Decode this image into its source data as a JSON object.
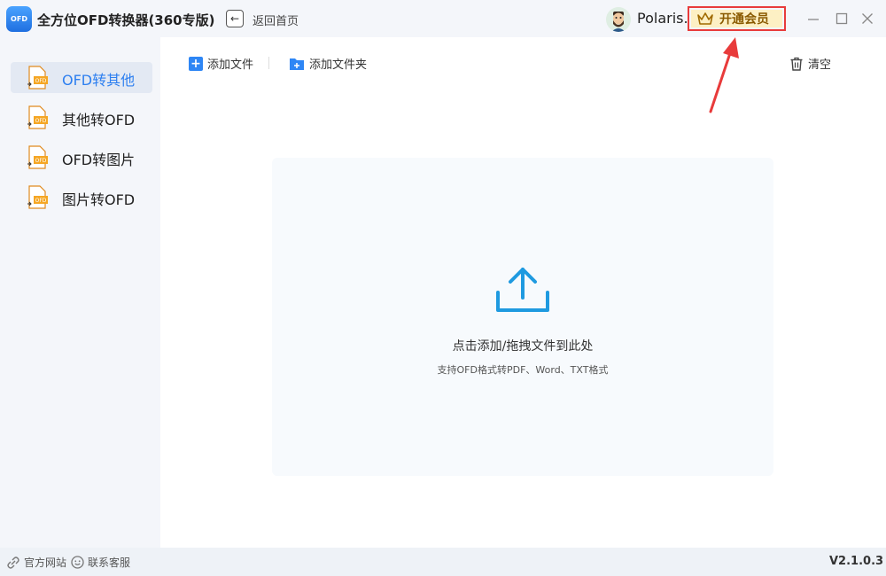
{
  "app": {
    "logo_text": "OFD",
    "title": "全方位OFD转换器(360专版)",
    "back_label": "返回首页"
  },
  "user": {
    "name": "Polaris.",
    "vip_label": "开通会员"
  },
  "sidebar": {
    "items": [
      {
        "label": "OFD转其他",
        "active": true
      },
      {
        "label": "其他转OFD",
        "active": false
      },
      {
        "label": "OFD转图片",
        "active": false
      },
      {
        "label": "图片转OFD",
        "active": false
      }
    ]
  },
  "toolbar": {
    "add_file": "添加文件",
    "add_folder": "添加文件夹",
    "clear": "清空"
  },
  "dropzone": {
    "title": "点击添加/拖拽文件到此处",
    "subtitle": "支持OFD格式转PDF、Word、TXT格式"
  },
  "footer": {
    "website": "官方网站",
    "support": "联系客服",
    "version": "V2.1.0.3"
  },
  "colors": {
    "accent": "#2d7ff0",
    "vip_border": "#e83b3b",
    "vip_bg": "#fdf0c4",
    "upload_icon": "#1f9ae0"
  }
}
